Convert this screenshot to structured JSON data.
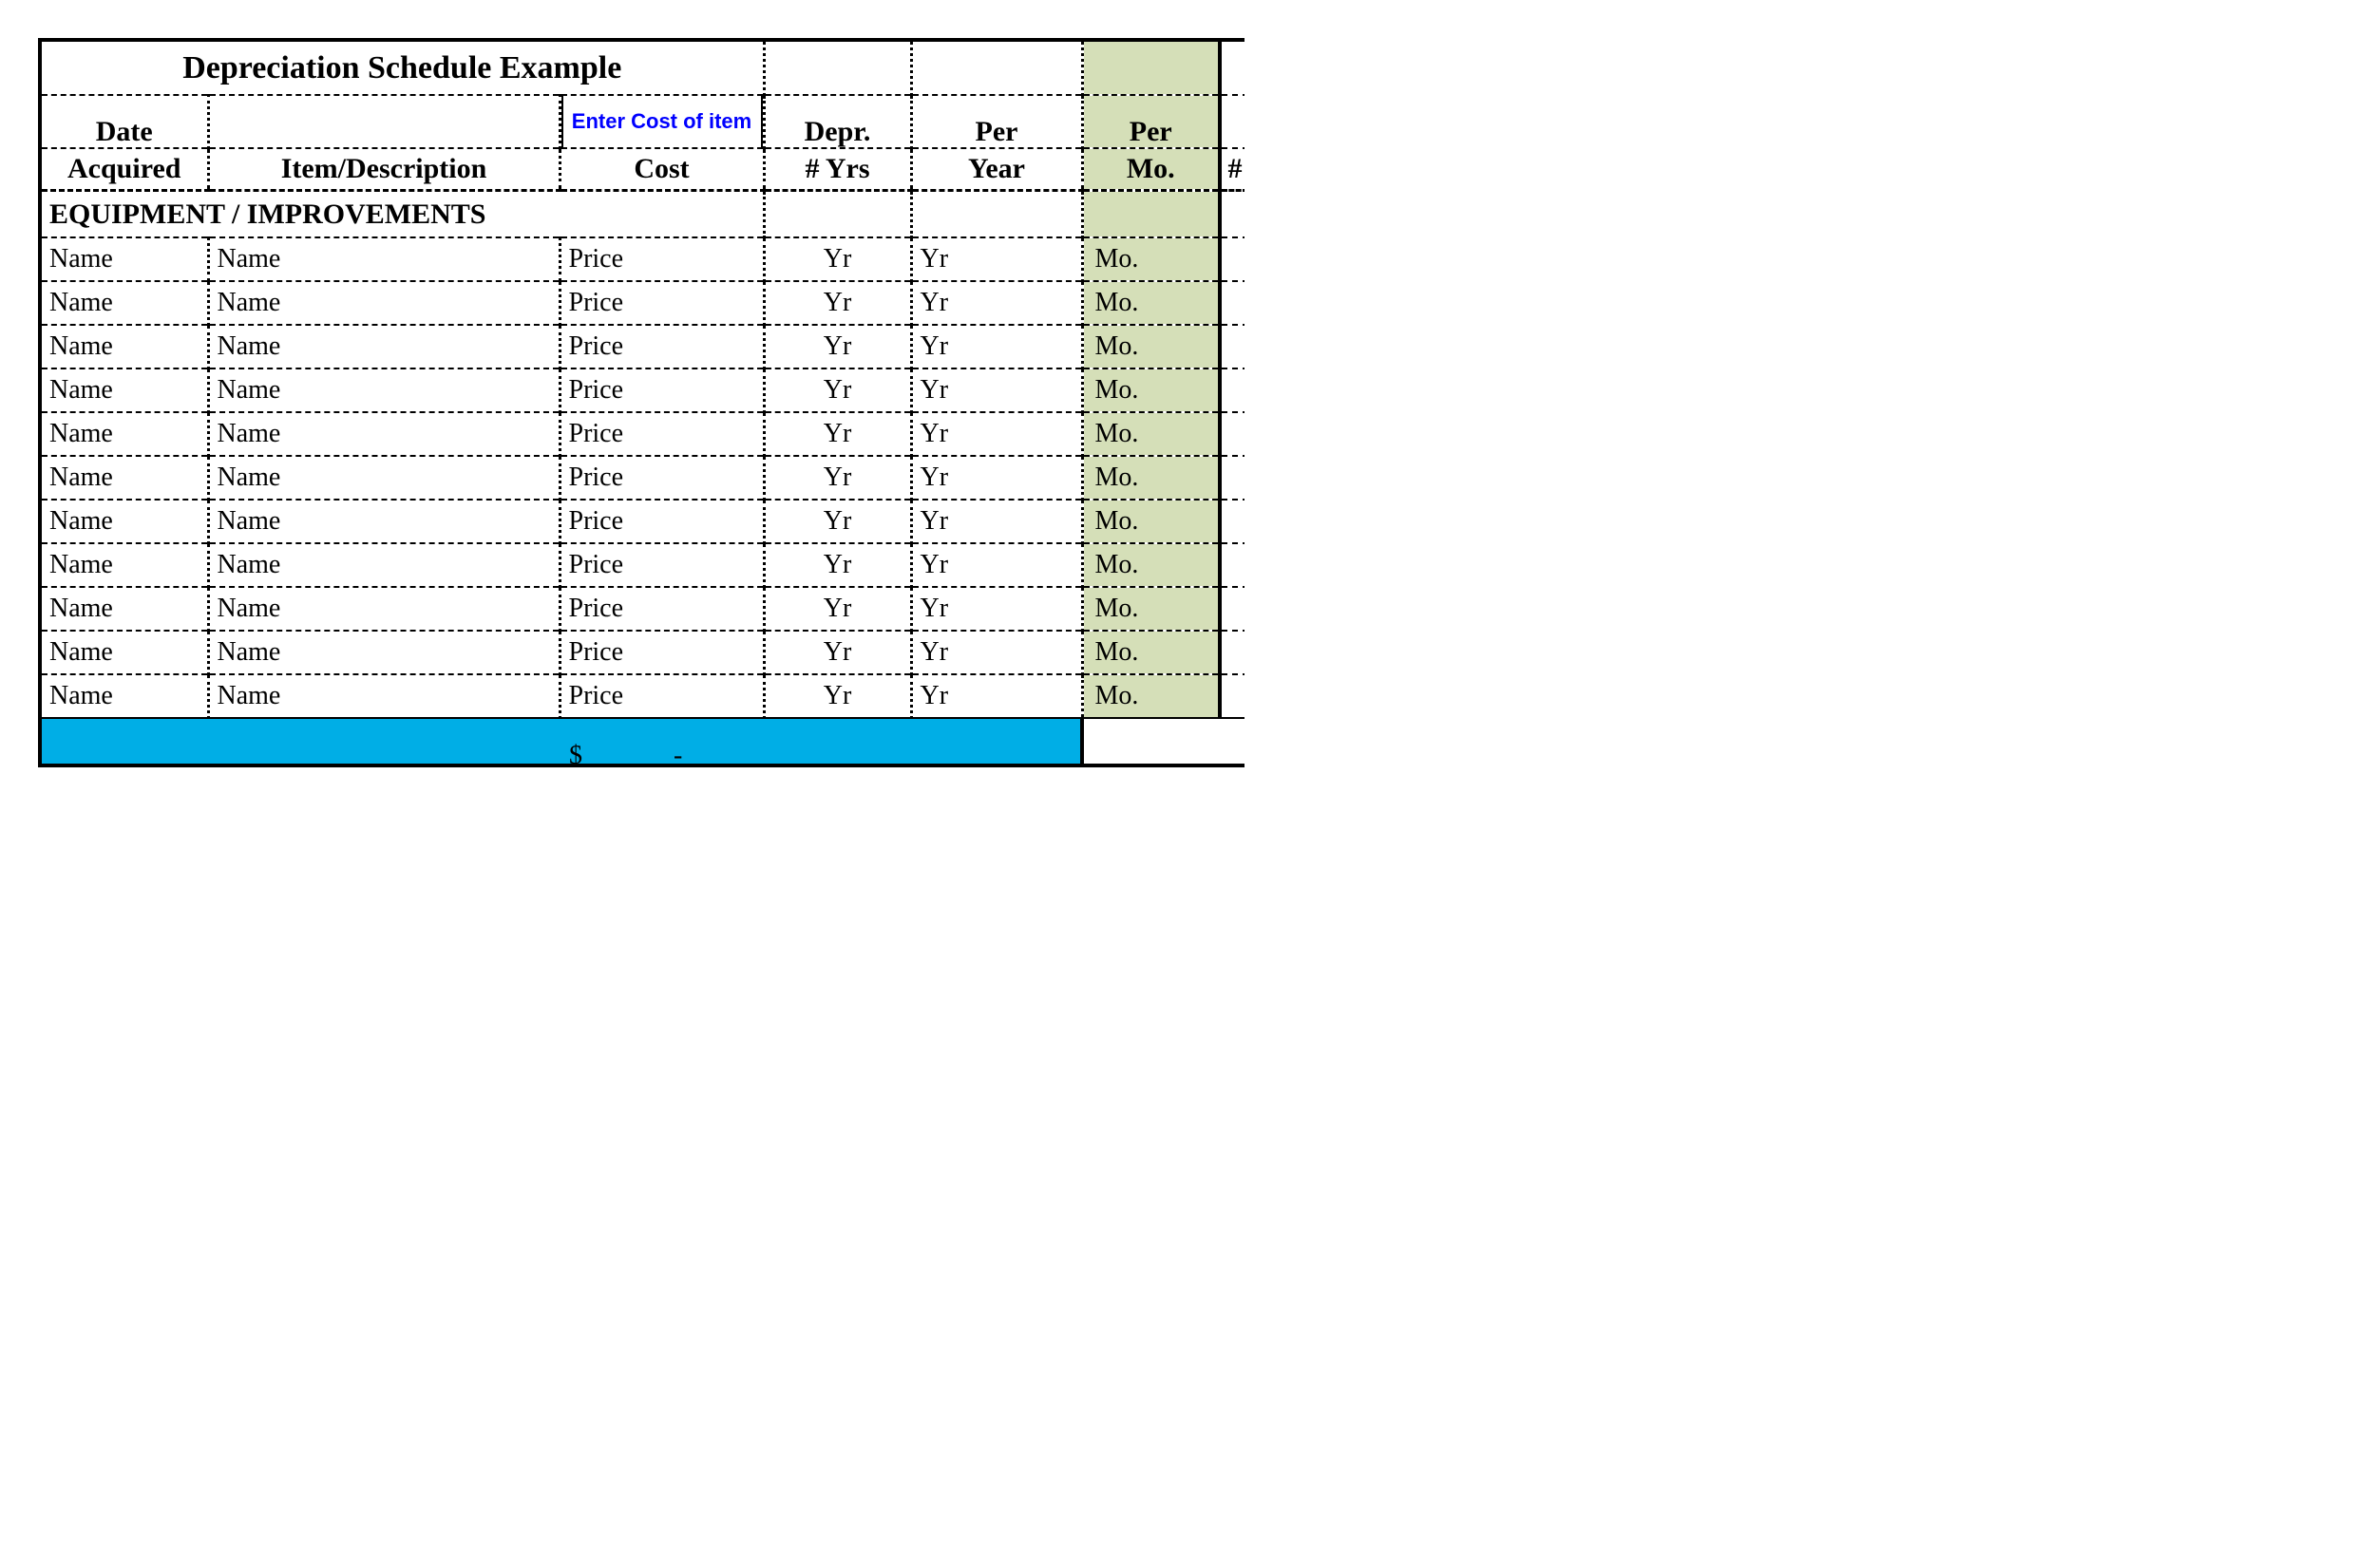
{
  "title": "Depreciation Schedule Example",
  "headers": {
    "date_top": "Date",
    "date_bottom": "Acquired",
    "item": "Item/Description",
    "cost_note": "Enter Cost of item",
    "cost": "Cost",
    "depr_top": "Depr.",
    "depr_bottom": "# Yrs",
    "per_top": "Per",
    "per_bottom": "Year",
    "permo_top": "Per",
    "permo_bottom": "Mo.",
    "tail": "#"
  },
  "section": "EQUIPMENT / IMPROVEMENTS",
  "rows": [
    {
      "date": "Name",
      "item": "Name",
      "cost": "Price",
      "depr": "Yr",
      "year": "Yr",
      "mo": "Mo."
    },
    {
      "date": "Name",
      "item": "Name",
      "cost": "Price",
      "depr": "Yr",
      "year": "Yr",
      "mo": "Mo."
    },
    {
      "date": "Name",
      "item": "Name",
      "cost": "Price",
      "depr": "Yr",
      "year": "Yr",
      "mo": "Mo."
    },
    {
      "date": "Name",
      "item": "Name",
      "cost": "Price",
      "depr": "Yr",
      "year": "Yr",
      "mo": "Mo."
    },
    {
      "date": "Name",
      "item": "Name",
      "cost": "Price",
      "depr": "Yr",
      "year": "Yr",
      "mo": "Mo."
    },
    {
      "date": "Name",
      "item": "Name",
      "cost": "Price",
      "depr": "Yr",
      "year": "Yr",
      "mo": "Mo."
    },
    {
      "date": "Name",
      "item": "Name",
      "cost": "Price",
      "depr": "Yr",
      "year": "Yr",
      "mo": "Mo."
    },
    {
      "date": "Name",
      "item": "Name",
      "cost": "Price",
      "depr": "Yr",
      "year": "Yr",
      "mo": "Mo."
    },
    {
      "date": "Name",
      "item": "Name",
      "cost": "Price",
      "depr": "Yr",
      "year": "Yr",
      "mo": "Mo."
    },
    {
      "date": "Name",
      "item": "Name",
      "cost": "Price",
      "depr": "Yr",
      "year": "Yr",
      "mo": "Mo."
    },
    {
      "date": "Name",
      "item": "Name",
      "cost": "Price",
      "depr": "Yr",
      "year": "Yr",
      "mo": "Mo."
    }
  ],
  "totals": {
    "dollar": "$",
    "dash": "-"
  }
}
